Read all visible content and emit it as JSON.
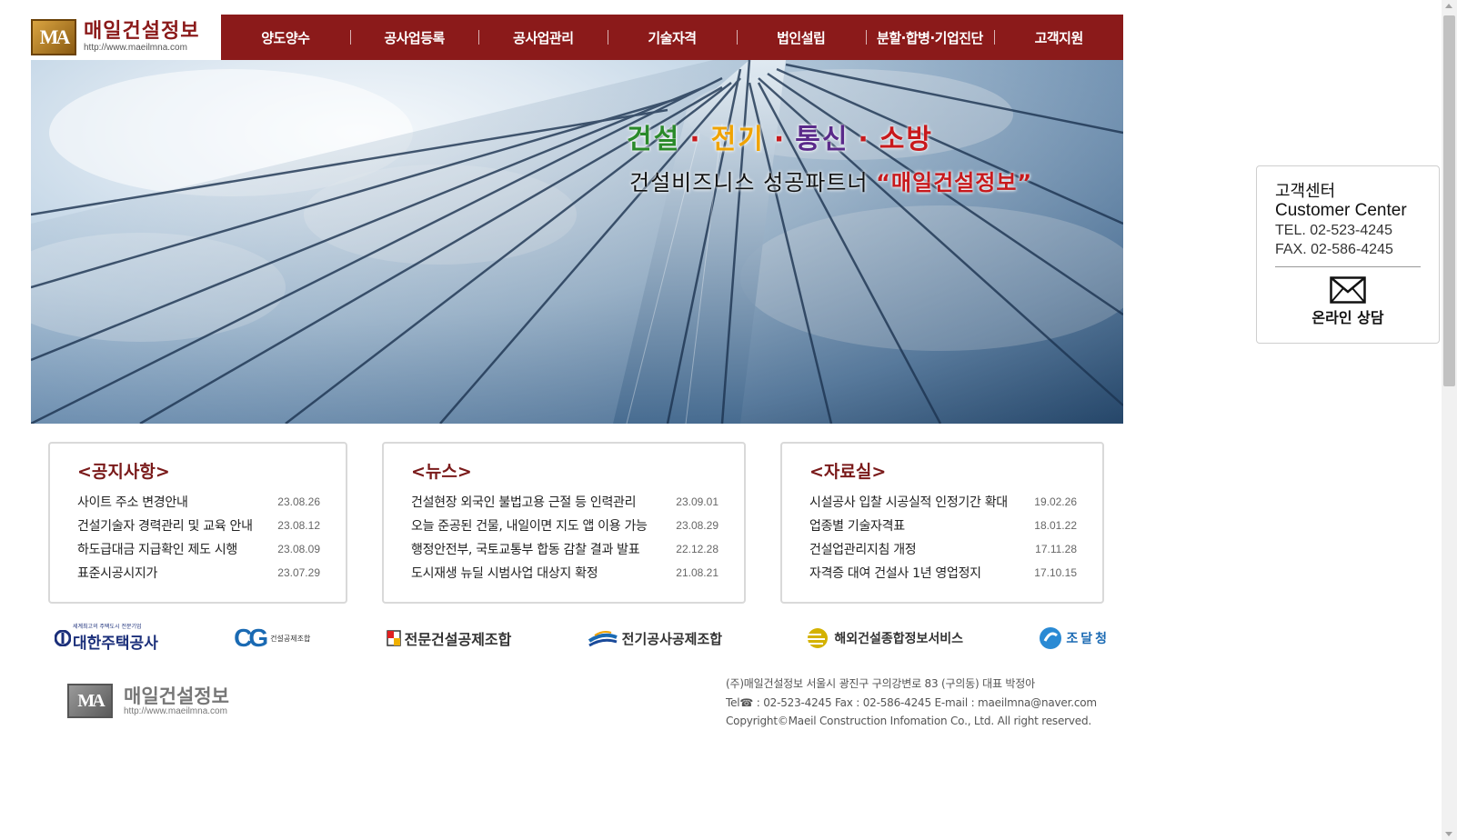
{
  "header": {
    "logo_mark": "MA",
    "logo_title": "매일건설정보",
    "logo_url": "http://www.maeilmna.com",
    "nav": [
      {
        "label": "양도양수"
      },
      {
        "label": "공사업등록"
      },
      {
        "label": "공사업관리"
      },
      {
        "label": "기술자격"
      },
      {
        "label": "법인설립"
      },
      {
        "label": "분할·합병·기업진단"
      },
      {
        "label": "고객지원"
      }
    ]
  },
  "hero": {
    "line1": [
      "건설",
      "전기",
      "통신",
      "소방"
    ],
    "separator": "·",
    "line2_plain": "건설비즈니스 성공파트너 ",
    "line2_highlight": "“매일건설정보”"
  },
  "customer_center": {
    "title": "고객센터",
    "subtitle": "Customer Center",
    "tel": "TEL. 02-523-4245",
    "fax": "FAX. 02-586-4245",
    "consult_label": "온라인 상담"
  },
  "boards": [
    {
      "title": "<공지사항>",
      "items": [
        {
          "text": "사이트 주소 변경안내",
          "date": "23.08.26"
        },
        {
          "text": "건설기술자 경력관리 및 교육 안내",
          "date": "23.08.12"
        },
        {
          "text": "하도급대금 지급확인 제도 시행",
          "date": "23.08.09"
        },
        {
          "text": "표준시공시지가",
          "date": "23.07.29"
        }
      ]
    },
    {
      "title": "<뉴스>",
      "items": [
        {
          "text": "건설현장 외국인 불법고용 근절 등 인력관리",
          "date": "23.09.01"
        },
        {
          "text": "오늘 준공된 건물, 내일이면 지도 앱 이용 가능",
          "date": "23.08.29"
        },
        {
          "text": "행정안전부, 국토교통부 합동 감찰 결과 발표",
          "date": "22.12.28"
        },
        {
          "text": "도시재생 뉴딜 시범사업 대상지 확정",
          "date": "21.08.21"
        }
      ]
    },
    {
      "title": "<자료실>",
      "items": [
        {
          "text": "시설공사 입찰 시공실적 인정기간 확대",
          "date": "19.02.26"
        },
        {
          "text": "업종별 기술자격표",
          "date": "18.01.22"
        },
        {
          "text": "건설업관리지침 개정",
          "date": "17.11.28"
        },
        {
          "text": "자격증 대여 건설사 1년 영업정지",
          "date": "17.10.15"
        }
      ]
    }
  ],
  "partners": {
    "p1_tiny": "세계최고의 주택도시 전문기업",
    "p1_name": "대한주택공사",
    "p2_mark": "CG",
    "p2_name": "건설공제조합",
    "p3_name": "전문건설공제조합",
    "p4_name": "전기공사공제조합",
    "p5_name": "해외건설종합정보서비스",
    "p6_name": "조달청"
  },
  "footer": {
    "logo_mark": "MA",
    "logo_title": "매일건설정보",
    "logo_url": "http://www.maeilmna.com",
    "address": "(주)매일건설정보 서울시 광진구 구의강변로 83 (구의동) 대표 박정아",
    "contact": "Tel☎ : 02-523-4245 Fax : 02-586-4245 E-mail : maeilmna@naver.com",
    "copyright": "Copyright©Maeil Construction Infomation Co., Ltd. All right reserved."
  },
  "colors": {
    "brand": "#8b1a1a",
    "board_title": "#7a1a1a",
    "hero_green": "#2a8a2a",
    "hero_orange": "#f0a300",
    "hero_purple": "#5a2a8a",
    "hero_red": "#c8191c"
  }
}
